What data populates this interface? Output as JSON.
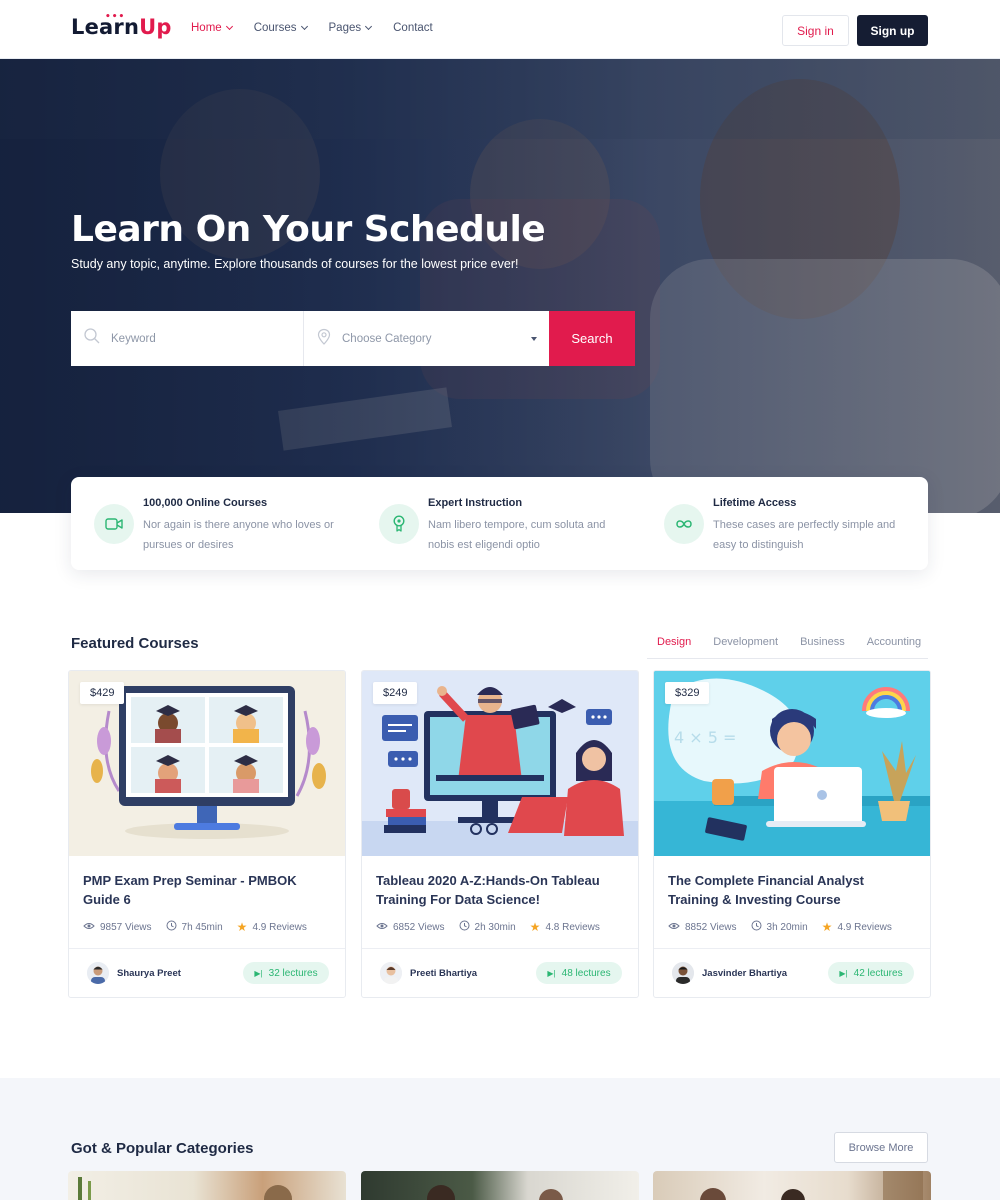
{
  "brand": {
    "logo_part1": "Learn",
    "logo_part2": "Up"
  },
  "nav": {
    "items": [
      {
        "label": "Home"
      },
      {
        "label": "Courses"
      },
      {
        "label": "Pages"
      },
      {
        "label": "Contact"
      }
    ],
    "signin_label": "Sign in",
    "signup_label": "Sign up"
  },
  "hero": {
    "title": "Learn On Your Schedule",
    "subtitle": "Study any topic, anytime. Explore thousands of courses for the lowest price ever!",
    "search": {
      "keyword_placeholder": "Keyword",
      "category_value": "Choose Category",
      "button_label": "Search"
    }
  },
  "features": [
    {
      "icon": "video-camera-icon",
      "title": "100,000 Online Courses",
      "desc": "Nor again is there anyone who loves or pursues or desires"
    },
    {
      "icon": "award-icon",
      "title": "Expert Instruction",
      "desc": "Nam libero tempore, cum soluta and nobis est eligendi optio"
    },
    {
      "icon": "infinity-icon",
      "title": "Lifetime Access",
      "desc": "These cases are perfectly simple and easy to distinguish"
    }
  ],
  "featured": {
    "title": "Featured Courses",
    "tabs": [
      "Design",
      "Development",
      "Business",
      "Accounting"
    ],
    "courses": [
      {
        "price": "$429",
        "title": "PMP Exam Prep Seminar - PMBOK Guide 6",
        "views": "9857 Views",
        "duration": "7h 45min",
        "rating": "4.9 Reviews",
        "author": "Shaurya Preet",
        "lectures": "32 lectures"
      },
      {
        "price": "$249",
        "title": "Tableau 2020 A-Z:Hands-On Tableau Training For Data Science!",
        "views": "6852 Views",
        "duration": "2h 30min",
        "rating": "4.8 Reviews",
        "author": "Preeti Bhartiya",
        "lectures": "48 lectures"
      },
      {
        "price": "$329",
        "title": "The Complete Financial Analyst Training & Investing Course",
        "views": "8852 Views",
        "duration": "3h 20min",
        "rating": "4.9 Reviews",
        "author": "Jasvinder Bhartiya",
        "lectures": "42 lectures"
      }
    ]
  },
  "categories": {
    "title": "Got & Popular Categories",
    "browse_label": "Browse More"
  },
  "colors": {
    "accent": "#e11b4d",
    "dark": "#151d33",
    "green": "#2bb673",
    "green_bg": "#e5f6ef"
  }
}
